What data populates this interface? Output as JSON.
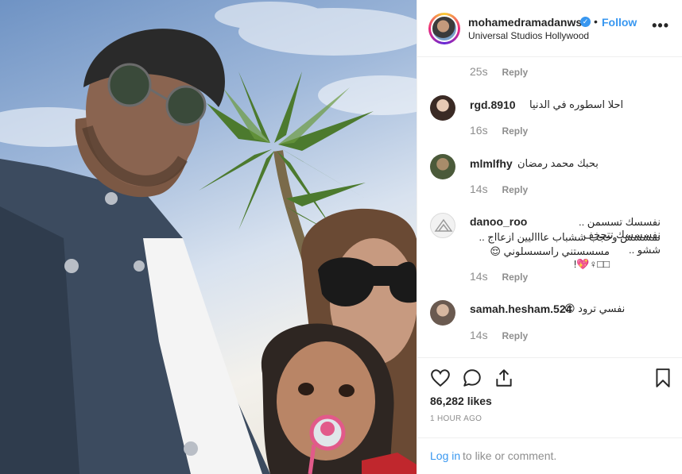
{
  "header": {
    "username": "mohamedramadanws",
    "dot": "•",
    "follow_label": "Follow",
    "location": "Universal Studios Hollywood",
    "more_label": "•••",
    "verified_mark": "✓"
  },
  "comments": [
    {
      "username": "",
      "text": "",
      "time": "25s",
      "reply": "Reply"
    },
    {
      "username": "rgd.8910",
      "text": "احلا اسطوره في الدنيا",
      "time": "16s",
      "reply": "Reply"
    },
    {
      "username": "mlmlfhy",
      "text": "بحبك محمد رمضان",
      "time": "14s",
      "reply": "Reply"
    },
    {
      "username": "danoo_roo",
      "text_lines": [
        "نفسسك تسسمن .. نفسسسك تتحخف",
        "نمششش وحجب ششباب عاااليين ازعااج .. ششو ..",
        "مسسستني راسسسلوني 😌□□♀💖!"
      ],
      "time": "14s",
      "reply": "Reply"
    },
    {
      "username": "samah.hesham.524",
      "text": "نفسي ترود 😌",
      "time": "14s",
      "reply": "Reply"
    }
  ],
  "actions": {
    "likes": "86,282 likes",
    "time": "1 HOUR AGO",
    "login_link": "Log in",
    "login_rest": "to like or comment.",
    "icons": [
      "heart-icon",
      "comment-icon",
      "share-icon",
      "bookmark-icon"
    ]
  },
  "colors": {
    "accent": "#3897f0",
    "text": "#262626",
    "muted": "#8e8e8e",
    "border": "#efefef"
  }
}
